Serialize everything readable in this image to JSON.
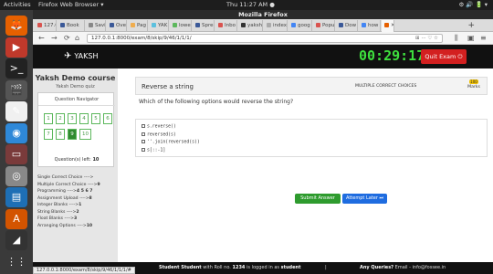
{
  "topbar": {
    "activities": "Activities",
    "app_menu": "Firefox Web Browser ▾",
    "clock": "Thu 11:27 AM ●",
    "tray": "⚙ 🔊 🔋 ▾"
  },
  "launcher": {
    "items": [
      {
        "name": "firefox-icon",
        "glyph": "🦊",
        "color": "#e66000"
      },
      {
        "name": "spreadsheet-icon",
        "glyph": "▶",
        "color": "#c0392b"
      },
      {
        "name": "terminal-icon",
        "glyph": ">_",
        "color": "#222222"
      },
      {
        "name": "clapper-icon",
        "glyph": "🎬",
        "color": "#555555"
      },
      {
        "name": "editor-icon",
        "glyph": "✎",
        "color": "#f0f0f0"
      },
      {
        "name": "chrome-icon",
        "glyph": "◉",
        "color": "#2e88d8"
      },
      {
        "name": "terminal-2-icon",
        "glyph": "▭",
        "color": "#7a3b3b"
      },
      {
        "name": "disk-icon",
        "glyph": "◎",
        "color": "#888888"
      },
      {
        "name": "writer-icon",
        "glyph": "▤",
        "color": "#1e6fb5"
      },
      {
        "name": "software-center-icon",
        "glyph": "A",
        "color": "#d35400"
      },
      {
        "name": "dock-icon",
        "glyph": "◢",
        "color": "#333333"
      },
      {
        "name": "apps-grid-icon",
        "glyph": "⋮⋮",
        "color": "#3a3a3a"
      }
    ]
  },
  "browser": {
    "title": "Mozilla Firefox",
    "tabs": [
      {
        "label": "127.0 ✕",
        "color": "#d9534f",
        "active": false
      },
      {
        "label": "Book",
        "color": "#3b5998",
        "active": false
      },
      {
        "label": "Saving",
        "color": "#888888",
        "active": false
      },
      {
        "label": "Ove",
        "color": "#3b5998",
        "active": false
      },
      {
        "label": "Pag",
        "color": "#f0ad4e",
        "active": false
      },
      {
        "label": "YAK",
        "color": "#5bc0de",
        "active": false
      },
      {
        "label": "lowe",
        "color": "#5cb85c",
        "active": false
      },
      {
        "label": "Spre",
        "color": "#3b5998",
        "active": false
      },
      {
        "label": "Inbo",
        "color": "#d9534f",
        "active": false
      },
      {
        "label": "yaksh/",
        "color": "#333333",
        "active": false
      },
      {
        "label": "index o",
        "color": "#aaaaaa",
        "active": false
      },
      {
        "label": "goog",
        "color": "#4285f4",
        "active": false
      },
      {
        "label": "Popu",
        "color": "#d9534f",
        "active": false
      },
      {
        "label": "Dow",
        "color": "#3b5998",
        "active": false
      },
      {
        "label": "how",
        "color": "#4285f4",
        "active": false
      },
      {
        "label": "✕",
        "color": "#e66000",
        "active": true
      }
    ],
    "new_tab": "+",
    "url": "127.0.0.1:8000/exam/8/skip/9/46/1/1/1/",
    "url_controls": "⊞ ··· ♡ ☆",
    "status_url": "127.0.0.1:8000/exam/8/skip/9/46/1/1/1/#"
  },
  "header": {
    "logo": "YAKSH",
    "timer": "00:29:17",
    "quit_label": "Quit Exam ⏻"
  },
  "sidebar": {
    "course_name": "Yaksh Demo course",
    "quiz_name": "Yaksh Demo quiz",
    "navigator_title": "Question Navigator",
    "questions": [
      "1",
      "2",
      "3",
      "4",
      "5",
      "6",
      "7",
      "8",
      "9",
      "10"
    ],
    "current_question": "9",
    "questions_left_label": "Question(s) left:",
    "questions_left": "10",
    "legend": [
      {
        "label": "Single Correct Choice ---->",
        "value": ""
      },
      {
        "label": "Multiple Correct Choice ---->",
        "value": "9"
      },
      {
        "label": "Programming ---->",
        "value": "4 5 6 7"
      },
      {
        "label": "Assignment Upload ---->",
        "value": "8"
      },
      {
        "label": "Integer Blanks ---->",
        "value": "1"
      },
      {
        "label": "String Blanks ---->",
        "value": "2"
      },
      {
        "label": "Float Blanks ---->",
        "value": "3"
      },
      {
        "label": "Arranging Options ---->",
        "value": "10"
      }
    ]
  },
  "question": {
    "title": "Reverse a string",
    "type": "MULTIPLE CORRECT CHOICES",
    "marks_badge": "100",
    "marks_label": "Marks",
    "text": "Which of the following options would reverse the string?",
    "options": [
      "s.reverse()",
      "reversed(s)",
      "''.join(reversed(s))",
      "s[::-1]"
    ]
  },
  "actions": {
    "submit": "Submit Answer",
    "later": "Attempt Later ⏭"
  },
  "footer": {
    "student_prefix": "Student Student",
    "student_mid": " with Roll no. ",
    "roll": "1234",
    "logged_in": " is logged in as ",
    "role": "student",
    "sep": "|",
    "queries_label": "Any Queries?",
    "queries_email": " Email - info@fossee.in"
  }
}
